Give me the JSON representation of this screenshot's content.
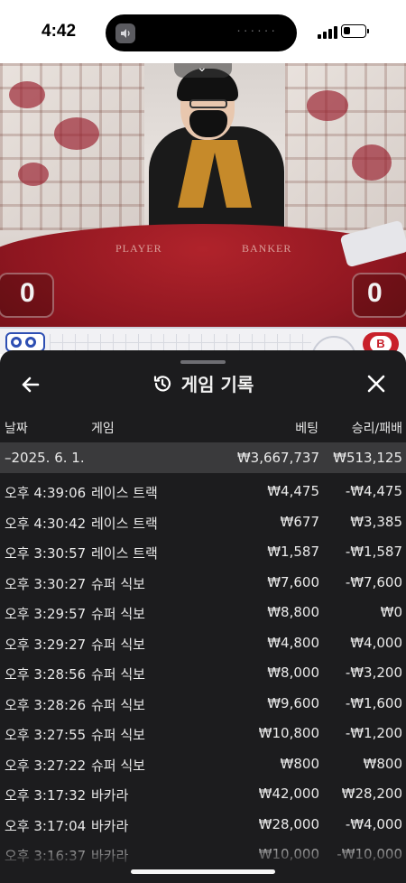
{
  "status_bar": {
    "time": "4:42",
    "island_dots": "······",
    "battery_level": 0.35
  },
  "video": {
    "table_label_player": "PLAYER",
    "table_label_banker": "BANKER",
    "score_player": "0",
    "score_banker": "0"
  },
  "strip": {
    "right_button": "B"
  },
  "panel": {
    "title": "게임 기록",
    "columns": {
      "date": "날짜",
      "game": "게임",
      "bet": "베팅",
      "result": "승리/패배"
    },
    "summary": {
      "date": "–2025. 6. 1.",
      "bet": "₩3,667,737",
      "result": "₩513,125"
    },
    "rows": [
      {
        "time": "오후 4:39:06",
        "game": "레이스 트랙",
        "bet": "₩4,475",
        "result": "-₩4,475"
      },
      {
        "time": "오후 4:30:42",
        "game": "레이스 트랙",
        "bet": "₩677",
        "result": "₩3,385"
      },
      {
        "time": "오후 3:30:57",
        "game": "레이스 트랙",
        "bet": "₩1,587",
        "result": "-₩1,587"
      },
      {
        "time": "오후 3:30:27",
        "game": "슈퍼 식보",
        "bet": "₩7,600",
        "result": "-₩7,600"
      },
      {
        "time": "오후 3:29:57",
        "game": "슈퍼 식보",
        "bet": "₩8,800",
        "result": "₩0"
      },
      {
        "time": "오후 3:29:27",
        "game": "슈퍼 식보",
        "bet": "₩4,800",
        "result": "₩4,000"
      },
      {
        "time": "오후 3:28:56",
        "game": "슈퍼 식보",
        "bet": "₩8,000",
        "result": "-₩3,200"
      },
      {
        "time": "오후 3:28:26",
        "game": "슈퍼 식보",
        "bet": "₩9,600",
        "result": "-₩1,600"
      },
      {
        "time": "오후 3:27:55",
        "game": "슈퍼 식보",
        "bet": "₩10,800",
        "result": "-₩1,200"
      },
      {
        "time": "오후 3:27:22",
        "game": "슈퍼 식보",
        "bet": "₩800",
        "result": "₩800"
      },
      {
        "time": "오후 3:17:32",
        "game": "바카라",
        "bet": "₩42,000",
        "result": "₩28,200"
      },
      {
        "time": "오후 3:17:04",
        "game": "바카라",
        "bet": "₩28,000",
        "result": "-₩4,000"
      },
      {
        "time": "오후 3:16:37",
        "game": "바카라",
        "bet": "₩10,000",
        "result": "-₩10,000"
      }
    ]
  }
}
